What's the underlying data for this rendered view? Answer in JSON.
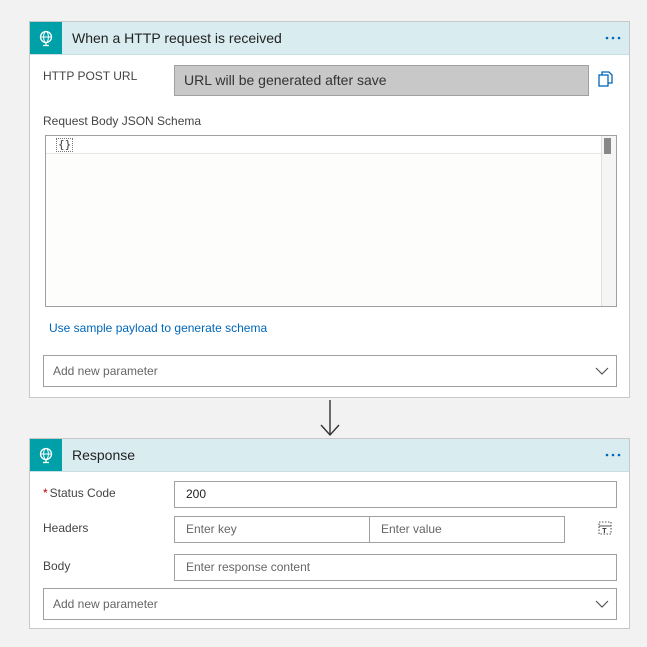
{
  "trigger": {
    "title": "When a HTTP request is received",
    "icon": "globe-icon",
    "url_label": "HTTP POST URL",
    "url_value": "URL will be generated after save",
    "schema_label": "Request Body JSON Schema",
    "schema_value": "{}",
    "sample_link": "Use sample payload to generate schema",
    "add_param_placeholder": "Add new parameter"
  },
  "response": {
    "title": "Response",
    "icon": "globe-icon",
    "status_label": "Status Code",
    "status_required": "*",
    "status_value": "200",
    "headers_label": "Headers",
    "header_key_placeholder": "Enter key",
    "header_value_placeholder": "Enter value",
    "body_label": "Body",
    "body_placeholder": "Enter response content",
    "add_param_placeholder": "Add new parameter"
  },
  "more_icon": "ellipsis-icon",
  "colors": {
    "header_bg": "#d9ecf0",
    "icon_bg": "#00a0a8",
    "link": "#0067b8",
    "required": "#c00000"
  }
}
